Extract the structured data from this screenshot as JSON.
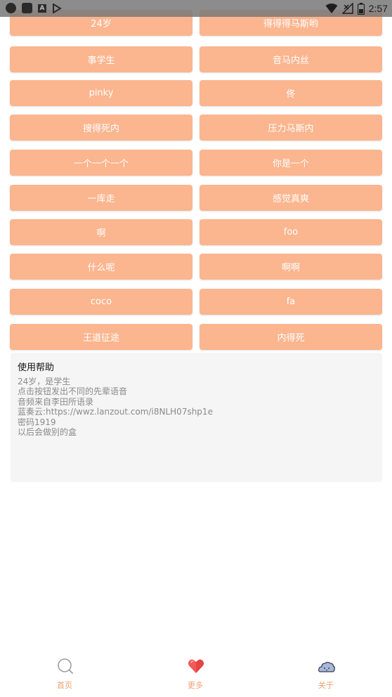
{
  "status_bar": {
    "time": "2:57",
    "notification_icons": [
      "circle-app-icon",
      "square-app-icon",
      "a-app-icon",
      "play-store-icon"
    ],
    "system_icons": [
      "wifi-icon",
      "no-signal-icon",
      "battery-icon"
    ]
  },
  "buttons": {
    "row1": {
      "left": "24岁",
      "right": "得得得马斯哟"
    },
    "row2": {
      "left": "事学生",
      "right": "音马内丝"
    },
    "row3": {
      "left": "pinky",
      "right": "佟"
    },
    "row4": {
      "left": "搜得死内",
      "right": "压力马斯内"
    },
    "row5": {
      "left": "一个一个一个",
      "right": "你是一个"
    },
    "row6": {
      "left": "一库走",
      "right": "感觉真爽"
    },
    "row7": {
      "left": "啊",
      "right": "foo"
    },
    "row8": {
      "left": "什么呢",
      "right": "啊啊"
    },
    "row9": {
      "left": "coco",
      "right": "fa"
    },
    "row10": {
      "left": "王道征途",
      "right": "内得死"
    }
  },
  "help": {
    "title": "使用帮助",
    "lines": [
      "24岁，是学生",
      "点击按钮发出不同的先辈语音",
      "音频来自李田所语录",
      "蓝奏云:https://wwz.lanzout.com/i8NLH07shp1e",
      "密码1919",
      "以后会做别的盒"
    ]
  },
  "nav": {
    "home": {
      "label": "首页",
      "icon": "search-icon"
    },
    "more": {
      "label": "更多",
      "icon": "heart-icon"
    },
    "about": {
      "label": "关于",
      "icon": "cloud-icon"
    }
  },
  "colors": {
    "button_bg": "#fbb58f",
    "button_text": "#ffffff",
    "nav_label": "#f0a070",
    "heart": "#f25a5a"
  }
}
